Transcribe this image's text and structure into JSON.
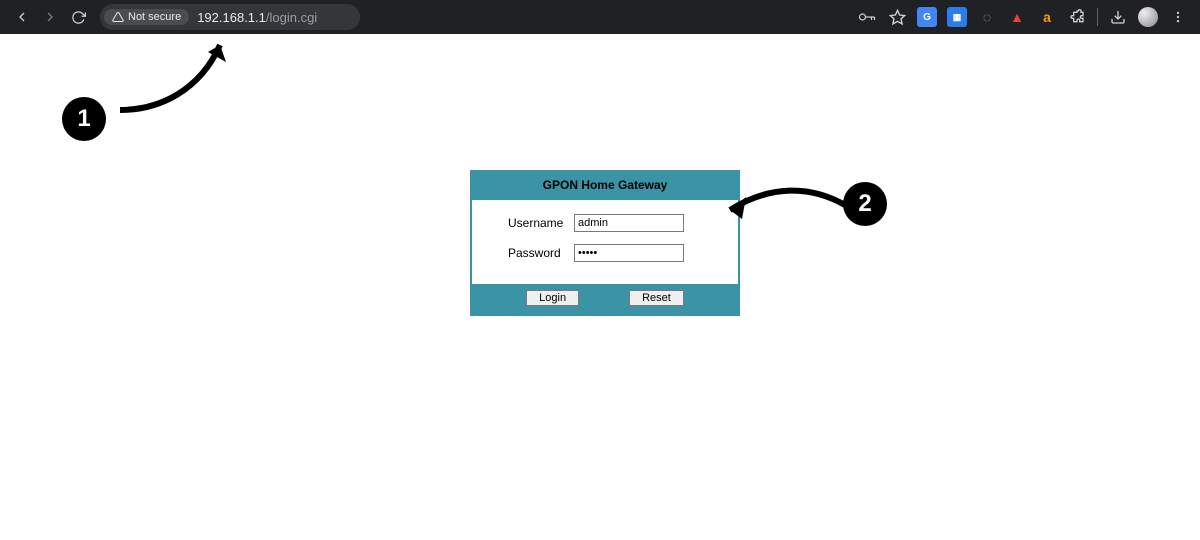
{
  "browser": {
    "security_label": "Not secure",
    "url_host": "192.168.1.1",
    "url_path": "/login.cgi"
  },
  "login": {
    "title": "GPON Home Gateway",
    "username_label": "Username",
    "password_label": "Password",
    "username_value": "admin",
    "password_value": "•••••",
    "login_btn": "Login",
    "reset_btn": "Reset"
  },
  "annotations": {
    "one": "1",
    "two": "2"
  },
  "icons": {
    "amazon_letter": "a",
    "translate_letter": "G"
  }
}
